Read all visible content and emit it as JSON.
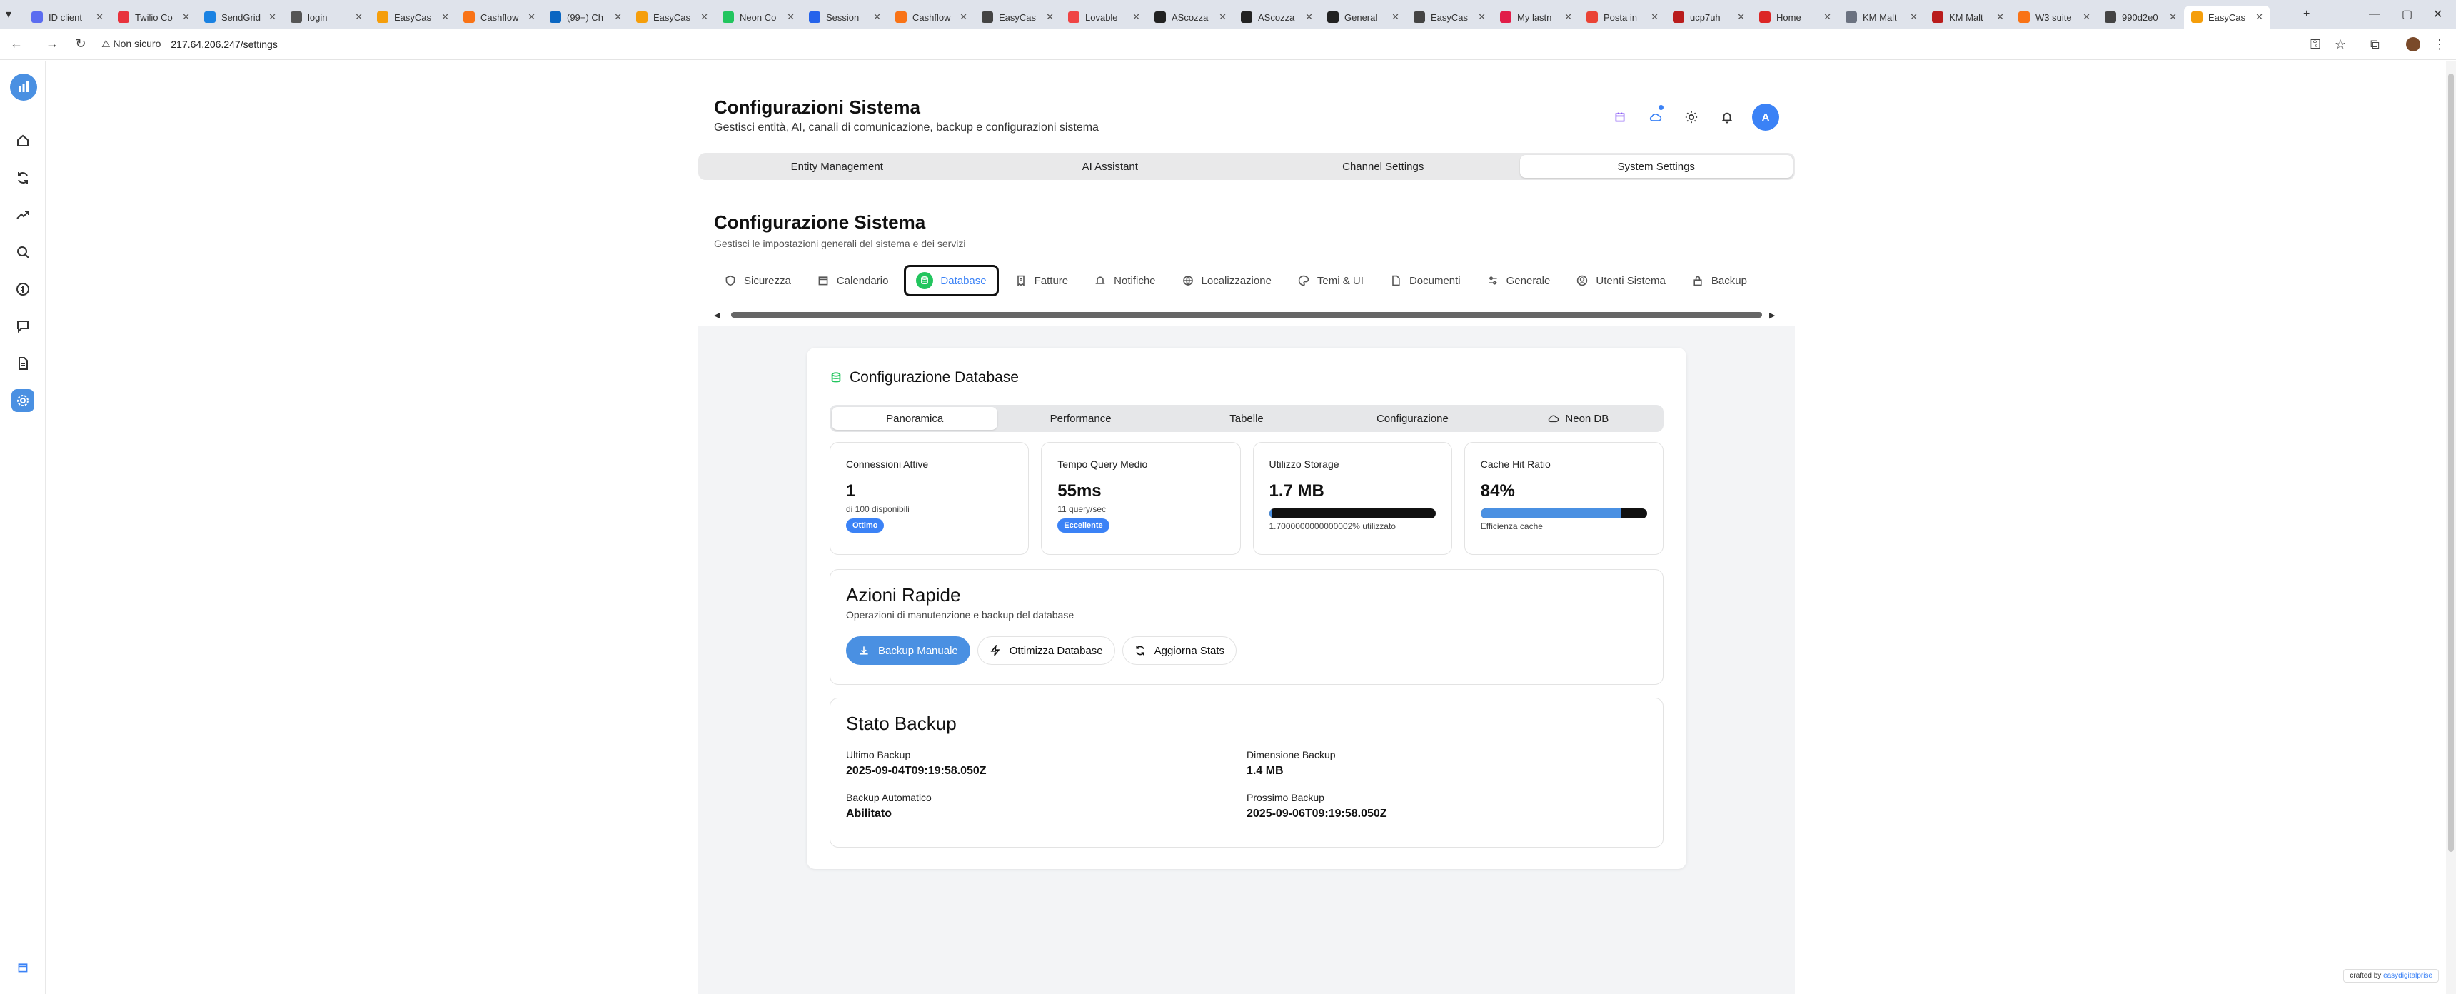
{
  "browser": {
    "tabs": [
      {
        "title": "ID client",
        "color": "#5b6cf0"
      },
      {
        "title": "Twilio Co",
        "color": "#e8323c"
      },
      {
        "title": "SendGrid",
        "color": "#1a82e2"
      },
      {
        "title": "login",
        "color": "#555555"
      },
      {
        "title": "EasyCas",
        "color": "#f59e0b"
      },
      {
        "title": "Cashflow",
        "color": "#f97316"
      },
      {
        "title": "(99+) Ch",
        "color": "#0a66c2"
      },
      {
        "title": "EasyCas",
        "color": "#f59e0b"
      },
      {
        "title": "Neon Co",
        "color": "#22c55e"
      },
      {
        "title": "Session",
        "color": "#2563eb"
      },
      {
        "title": "Cashflow",
        "color": "#f97316"
      },
      {
        "title": "EasyCas",
        "color": "#444444"
      },
      {
        "title": "Lovable",
        "color": "#ef4444"
      },
      {
        "title": "AScozza",
        "color": "#222222"
      },
      {
        "title": "AScozza",
        "color": "#222222"
      },
      {
        "title": "General",
        "color": "#222222"
      },
      {
        "title": "EasyCas",
        "color": "#444444"
      },
      {
        "title": "My lastn",
        "color": "#e11d48"
      },
      {
        "title": "Posta in",
        "color": "#ea4335"
      },
      {
        "title": "ucp7uh",
        "color": "#b91c1c"
      },
      {
        "title": "Home",
        "color": "#dc2626"
      },
      {
        "title": "KM Malt",
        "color": "#6b7280"
      },
      {
        "title": "KM Malt",
        "color": "#b91c1c"
      },
      {
        "title": "W3 suite",
        "color": "#f97316"
      },
      {
        "title": "990d2e0",
        "color": "#444444"
      },
      {
        "title": "EasyCas",
        "color": "#f59e0b"
      }
    ],
    "not_secure": "Non sicuro",
    "url": "217.64.206.247/settings"
  },
  "header": {
    "title": "Configurazioni Sistema",
    "subtitle": "Gestisci entità, AI, canali di comunicazione, backup e configurazioni sistema",
    "avatar_letter": "A"
  },
  "main_tabs": [
    "Entity Management",
    "AI Assistant",
    "Channel Settings",
    "System Settings"
  ],
  "section": {
    "title": "Configurazione Sistema",
    "subtitle": "Gestisci le impostazioni generali del sistema e dei servizi"
  },
  "sub_tabs": [
    "Sicurezza",
    "Calendario",
    "Database",
    "Fatture",
    "Notifiche",
    "Localizzazione",
    "Temi & UI",
    "Documenti",
    "Generale",
    "Utenti Sistema",
    "Backup"
  ],
  "db": {
    "title": "Configurazione Database",
    "tabs": [
      "Panoramica",
      "Performance",
      "Tabelle",
      "Configurazione",
      "Neon DB"
    ],
    "stats": {
      "connections": {
        "label": "Connessioni Attive",
        "value": "1",
        "sub": "di 100 disponibili",
        "badge": "Ottimo"
      },
      "query": {
        "label": "Tempo Query Medio",
        "value": "55ms",
        "sub": "11 query/sec",
        "badge": "Eccellente"
      },
      "storage": {
        "label": "Utilizzo Storage",
        "value": "1.7 MB",
        "sub": "1.7000000000000002% utilizzato",
        "fill": 0.017
      },
      "cache": {
        "label": "Cache Hit Ratio",
        "value": "84%",
        "sub": "Efficienza cache",
        "fill": 0.84
      }
    },
    "quick": {
      "title": "Azioni Rapide",
      "subtitle": "Operazioni di manutenzione e backup del database",
      "backup_btn": "Backup Manuale",
      "optimize_btn": "Ottimizza Database",
      "refresh_btn": "Aggiorna Stats"
    },
    "backup": {
      "title": "Stato Backup",
      "last_label": "Ultimo Backup",
      "last_value": "2025-09-04T09:19:58.050Z",
      "size_label": "Dimensione Backup",
      "size_value": "1.4 MB",
      "auto_label": "Backup Automatico",
      "auto_value": "Abilitato",
      "next_label": "Prossimo Backup",
      "next_value": "2025-09-06T09:19:58.050Z"
    }
  },
  "footer": {
    "crafted_prefix": "crafted by",
    "crafted_brand": "easydigitalprise"
  }
}
